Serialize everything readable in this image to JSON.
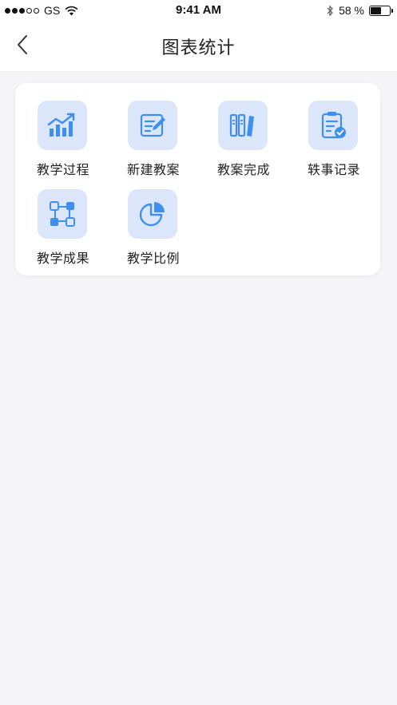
{
  "status_bar": {
    "carrier": "GS",
    "time": "9:41 AM",
    "battery_text": "58 %",
    "battery_level": 0.58
  },
  "nav": {
    "title": "图表统计",
    "back_icon": "chevron-left-icon"
  },
  "menu": {
    "items": [
      {
        "label": "教学过程",
        "icon": "trend-chart-icon"
      },
      {
        "label": "新建教案",
        "icon": "edit-document-icon"
      },
      {
        "label": "教案完成",
        "icon": "books-icon"
      },
      {
        "label": "轶事记录",
        "icon": "clipboard-check-icon"
      },
      {
        "label": "教学成果",
        "icon": "nodes-icon"
      },
      {
        "label": "教学比例",
        "icon": "pie-chart-icon"
      }
    ]
  },
  "colors": {
    "tile_bg": "#dbe6fb",
    "icon_blue": "#3f8ff0",
    "page_bg": "#f5f5f7"
  }
}
